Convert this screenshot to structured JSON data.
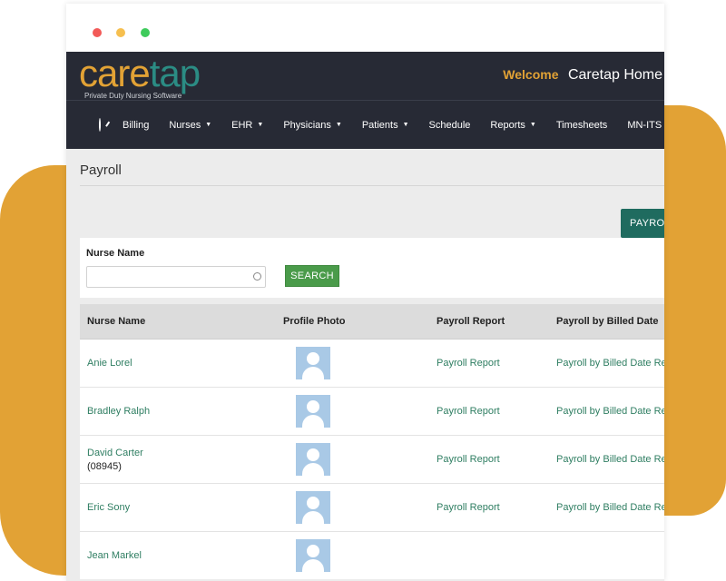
{
  "header": {
    "logo_care": "care",
    "logo_tap": "tap",
    "logo_tagline": "Private Duty Nursing Software",
    "welcome_label": "Welcome",
    "welcome_name": "Caretap Home"
  },
  "nav": {
    "items": [
      {
        "label": "Billing"
      },
      {
        "label": "Nurses",
        "caret": "▼"
      },
      {
        "label": "EHR",
        "caret": "▼"
      },
      {
        "label": "Physicians",
        "caret": "▼"
      },
      {
        "label": "Patients",
        "caret": "▼"
      },
      {
        "label": "Schedule"
      },
      {
        "label": "Reports",
        "caret": "▼"
      },
      {
        "label": "Timesheets"
      },
      {
        "label": "MN-ITS"
      }
    ]
  },
  "page": {
    "title": "Payroll",
    "top_button": "PAYROL"
  },
  "search": {
    "label": "Nurse Name",
    "value": "",
    "placeholder": "",
    "button": "SEARCH"
  },
  "table": {
    "headers": [
      "Nurse Name",
      "Profile Photo",
      "Payroll Report",
      "Payroll by Billed Date"
    ],
    "rows": [
      {
        "name": "Anie Lorel",
        "id": "",
        "report": "Payroll Report",
        "billed": "Payroll by Billed Date Re"
      },
      {
        "name": "Bradley Ralph",
        "id": "",
        "report": "Payroll Report",
        "billed": "Payroll by Billed Date Re"
      },
      {
        "name": "David Carter",
        "id": "(08945)",
        "report": "Payroll Report",
        "billed": "Payroll by Billed Date Re"
      },
      {
        "name": "Eric Sony",
        "id": "",
        "report": "Payroll Report",
        "billed": "Payroll by Billed Date Re"
      },
      {
        "name": "Jean Markel",
        "id": "",
        "report": "",
        "billed": ""
      }
    ]
  },
  "colors": {
    "accent_orange": "#e2a235",
    "brand_teal": "#2b8c84",
    "header_dark": "#272a35",
    "link_green": "#2f7e62",
    "search_green": "#4a9b4a"
  }
}
